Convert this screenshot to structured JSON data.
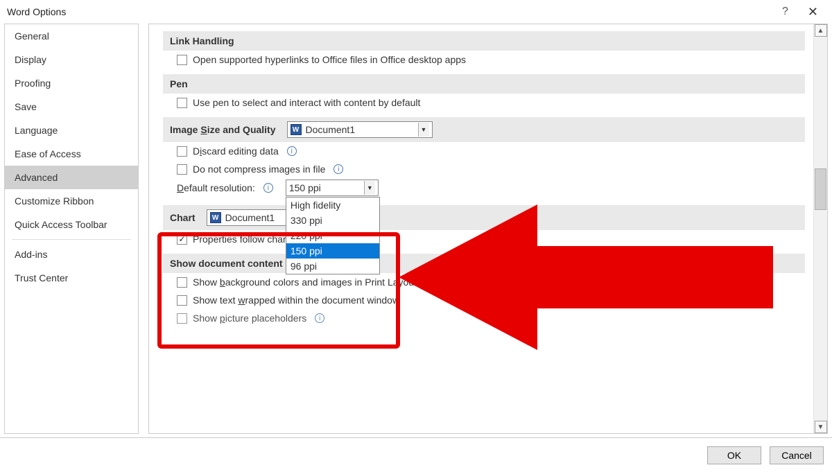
{
  "title": "Word Options",
  "sidebar": {
    "items": [
      {
        "label": "General"
      },
      {
        "label": "Display"
      },
      {
        "label": "Proofing"
      },
      {
        "label": "Save"
      },
      {
        "label": "Language"
      },
      {
        "label": "Ease of Access"
      },
      {
        "label": "Advanced",
        "selected": true
      },
      {
        "label": "Customize Ribbon"
      },
      {
        "label": "Quick Access Toolbar"
      },
      {
        "label": "Add-ins"
      },
      {
        "label": "Trust Center"
      }
    ]
  },
  "sections": {
    "link_handling": {
      "title": "Link Handling",
      "open_hyperlinks": "Open supported hyperlinks to Office files in Office desktop apps"
    },
    "pen": {
      "title": "Pen",
      "use_pen": "Use pen to select and interact with content by default"
    },
    "image": {
      "title": "Image Size and Quality",
      "doc_name": "Document1",
      "discard": "Discard editing data",
      "no_compress": "Do not compress images in file",
      "default_res_label": "Default resolution:",
      "default_res_value": "150 ppi",
      "options": [
        "High fidelity",
        "330 ppi",
        "220 ppi",
        "150 ppi",
        "96 ppi"
      ]
    },
    "chart": {
      "title": "Chart",
      "doc_name": "Document1",
      "properties_follow": "Properties follow chart data point"
    },
    "show_doc": {
      "title": "Show document content",
      "bg_colors": "Show background colors and images in Print Layout view",
      "text_wrapped": "Show text wrapped within the document window",
      "picture_placeholders": "Show picture placeholders"
    }
  },
  "footer": {
    "ok": "OK",
    "cancel": "Cancel"
  }
}
